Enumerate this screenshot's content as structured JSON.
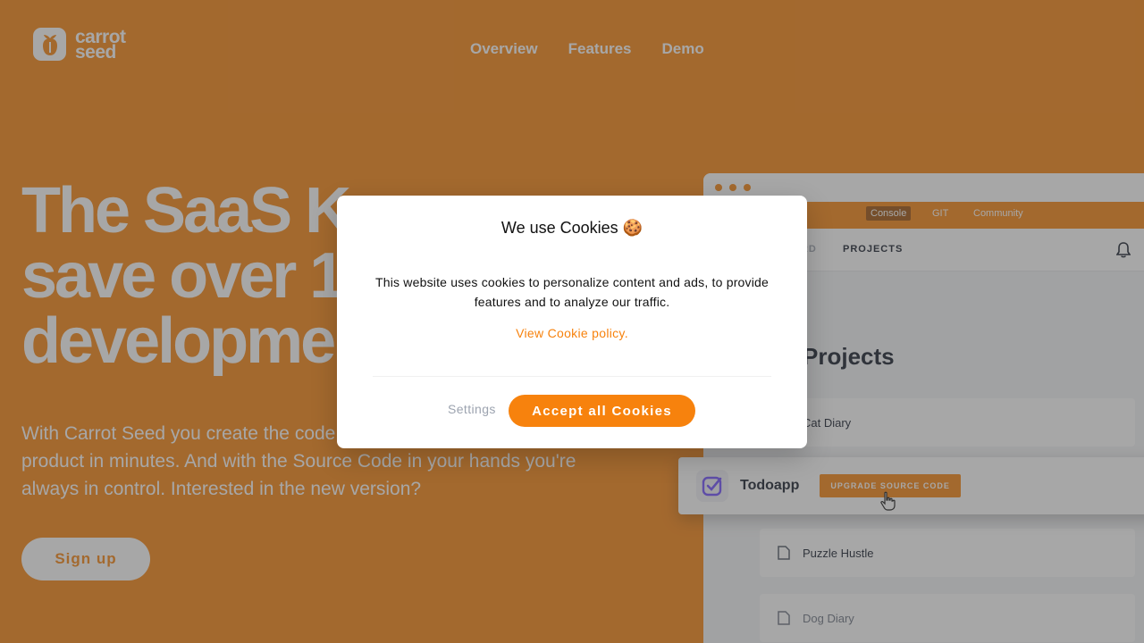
{
  "brand": {
    "name_line1": "carrot",
    "name_line2": "seed",
    "accent": "#f7820d"
  },
  "nav": {
    "items": [
      {
        "label": "Overview"
      },
      {
        "label": "Features"
      },
      {
        "label": "Demo"
      }
    ]
  },
  "hero": {
    "title": "The SaaS Kit to save over 1 development",
    "title_visible": [
      "The SaaS K",
      "save over 1",
      "developme"
    ],
    "subtitle_line1": "With Carrot Seed you create the code",
    "subtitle_line2": "product in minutes. And with the Source Code in your hands you're",
    "subtitle_line3": "always in control. Interested in the new version?",
    "signup_label": "Sign up"
  },
  "mock": {
    "bar_tabs": [
      {
        "label": "Console"
      },
      {
        "label": "GIT"
      },
      {
        "label": "Community"
      }
    ],
    "nav_partial": "ARD",
    "nav_projects": "PROJECTS",
    "heading": "Projects",
    "projects": [
      {
        "name": "Cat Diary"
      },
      {
        "name": "Puzzle Hustle"
      },
      {
        "name": "Dog Diary"
      }
    ],
    "featured": {
      "name": "Todoapp",
      "button": "UPGRADE SOURCE CODE"
    }
  },
  "cookie_modal": {
    "title": "We use Cookies 🍪",
    "body": "This website uses cookies to personalize content and ads, to provide features and to analyze our traffic.",
    "policy_link": "View Cookie policy.",
    "settings_label": "Settings",
    "accept_label": "Accept all Cookies"
  }
}
